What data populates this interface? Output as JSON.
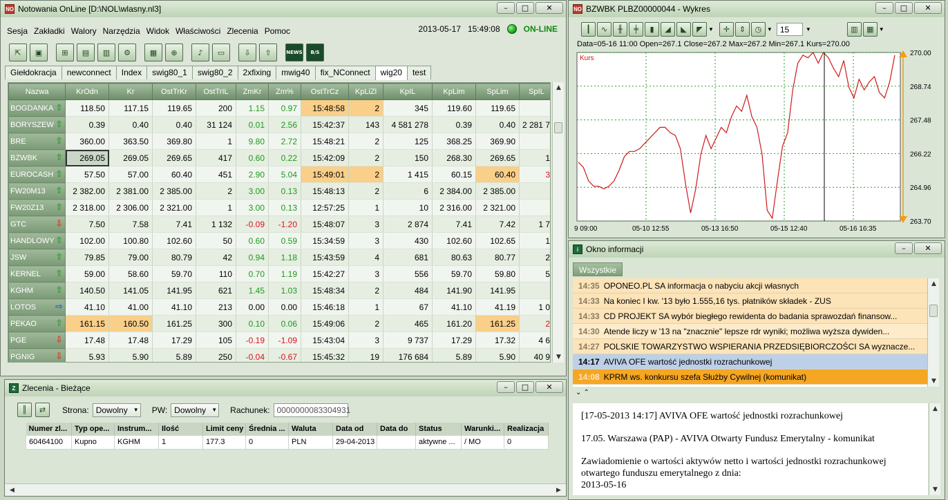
{
  "main_window": {
    "title": "Notowania OnLine [D:\\NOL\\wlasny.nl3]",
    "menu": [
      "Sesja",
      "Zakładki",
      "Walory",
      "Narzędzia",
      "Widok",
      "Właściwości",
      "Zlecenia",
      "Pomoc"
    ],
    "date": "2013-05-17",
    "time": "15:49:08",
    "status": "ON-LINE",
    "tabs": [
      "Giełdokracja",
      "newconnect",
      "Index",
      "swig80_1",
      "swig80_2",
      "2xfixing",
      "mwig40",
      "fix_NConnect",
      "wig20",
      "test"
    ],
    "active_tab": "wig20",
    "columns": [
      "Nazwa",
      "KrOdn",
      "Kr",
      "OstTrKr",
      "OstTrIL",
      "ZmKr",
      "Zm%",
      "OstTrCz",
      "KpLiZl",
      "KpIL",
      "KpLim",
      "SpLim",
      "SpIL"
    ],
    "rows": [
      {
        "n": "BOGDANKA",
        "a": "up",
        "v": [
          "118.50",
          "117.15",
          "119.65",
          "200",
          "1.15",
          "0.97",
          "15:48:58",
          "2",
          "345",
          "119.60",
          "119.65",
          ""
        ]
      },
      {
        "n": "BORYSZEW",
        "a": "up",
        "v": [
          "0.39",
          "0.40",
          "0.40",
          "31 124",
          "0.01",
          "2.56",
          "15:42:37",
          "143",
          "4 581 278",
          "0.39",
          "0.40",
          "2 281 7"
        ]
      },
      {
        "n": "BRE",
        "a": "up",
        "v": [
          "360.00",
          "363.50",
          "369.80",
          "1",
          "9.80",
          "2.72",
          "15:48:21",
          "2",
          "125",
          "368.25",
          "369.90",
          ""
        ]
      },
      {
        "n": "BZWBK",
        "a": "up",
        "v": [
          "269.05",
          "269.05",
          "269.65",
          "417",
          "0.60",
          "0.22",
          "15:42:09",
          "2",
          "150",
          "268.30",
          "269.65",
          "1"
        ]
      },
      {
        "n": "EUROCASH",
        "a": "up",
        "v": [
          "57.50",
          "57.00",
          "60.40",
          "451",
          "2.90",
          "5.04",
          "15:49:01",
          "2",
          "1 415",
          "60.15",
          "60.40",
          "3"
        ]
      },
      {
        "n": "FW20M13",
        "a": "up",
        "v": [
          "2 382.00",
          "2 381.00",
          "2 385.00",
          "2",
          "3.00",
          "0.13",
          "15:48:13",
          "2",
          "6",
          "2 384.00",
          "2 385.00",
          ""
        ]
      },
      {
        "n": "FW20Z13",
        "a": "up",
        "v": [
          "2 318.00",
          "2 306.00",
          "2 321.00",
          "1",
          "3.00",
          "0.13",
          "12:57:25",
          "1",
          "10",
          "2 316.00",
          "2 321.00",
          ""
        ]
      },
      {
        "n": "GTC",
        "a": "down",
        "v": [
          "7.50",
          "7.58",
          "7.41",
          "1 132",
          "-0.09",
          "-1.20",
          "15:48:07",
          "3",
          "2 874",
          "7.41",
          "7.42",
          "1 7"
        ]
      },
      {
        "n": "HANDLOWY",
        "a": "up",
        "v": [
          "102.00",
          "100.80",
          "102.60",
          "50",
          "0.60",
          "0.59",
          "15:34:59",
          "3",
          "430",
          "102.60",
          "102.65",
          "1"
        ]
      },
      {
        "n": "JSW",
        "a": "up",
        "v": [
          "79.85",
          "79.00",
          "80.79",
          "42",
          "0.94",
          "1.18",
          "15:43:59",
          "4",
          "681",
          "80.63",
          "80.77",
          "2"
        ]
      },
      {
        "n": "KERNEL",
        "a": "up",
        "v": [
          "59.00",
          "58.60",
          "59.70",
          "110",
          "0.70",
          "1.19",
          "15:42:27",
          "3",
          "556",
          "59.70",
          "59.80",
          "5"
        ]
      },
      {
        "n": "KGHM",
        "a": "up",
        "v": [
          "140.50",
          "141.05",
          "141.95",
          "621",
          "1.45",
          "1.03",
          "15:48:34",
          "2",
          "484",
          "141.90",
          "141.95",
          ""
        ]
      },
      {
        "n": "LOTOS",
        "a": "flat",
        "v": [
          "41.10",
          "41.00",
          "41.10",
          "213",
          "0.00",
          "0.00",
          "15:46:18",
          "1",
          "67",
          "41.10",
          "41.19",
          "1 0"
        ]
      },
      {
        "n": "PEKAO",
        "a": "up",
        "v": [
          "161.15",
          "160.50",
          "161.25",
          "300",
          "0.10",
          "0.06",
          "15:49:06",
          "2",
          "465",
          "161.20",
          "161.25",
          "2"
        ]
      },
      {
        "n": "PGE",
        "a": "down",
        "v": [
          "17.48",
          "17.48",
          "17.29",
          "105",
          "-0.19",
          "-1.09",
          "15:43:04",
          "3",
          "9 737",
          "17.29",
          "17.32",
          "4 6"
        ]
      },
      {
        "n": "PGNIG",
        "a": "down",
        "v": [
          "5.93",
          "5.90",
          "5.89",
          "250",
          "-0.04",
          "-0.67",
          "15:45:32",
          "19",
          "176 684",
          "5.89",
          "5.90",
          "40 9"
        ]
      }
    ]
  },
  "chart_window": {
    "title": "BZWBK PLBZ00000044 - Wykres",
    "period": "15",
    "info": "Data=05-16 11:00 Open=267.1 Close=267.2 Max=267.2 Min=267.1 Kurs=270.00",
    "legend": "Kurs"
  },
  "chart_data": {
    "type": "line",
    "series": [
      {
        "name": "Kurs",
        "values": [
          265.9,
          265.7,
          265.2,
          265.0,
          265.0,
          264.9,
          265.0,
          265.2,
          265.6,
          266.1,
          266.3,
          266.3,
          266.4,
          266.6,
          266.8,
          267.0,
          267.2,
          267.2,
          267.0,
          266.9,
          266.4,
          265.1,
          264.0,
          264.9,
          266.2,
          266.9,
          266.4,
          266.8,
          267.2,
          267.0,
          267.6,
          268.0,
          267.8,
          268.4,
          267.6,
          267.2,
          266.2,
          264.1,
          263.8,
          265.2,
          266.5,
          267.0,
          268.6,
          269.6,
          269.9,
          269.8,
          270.0,
          269.6,
          270.0,
          269.8,
          269.4,
          269.1,
          269.7,
          268.7,
          268.3,
          269.0,
          268.6,
          268.9,
          269.1,
          268.5,
          268.3,
          268.9,
          269.9
        ]
      }
    ],
    "x_ticks": [
      "9 09:00",
      "05-10 12:55",
      "05-13 16:50",
      "05-15 12:40",
      "05-16 16:35"
    ],
    "y_ticks": [
      "270.00",
      "268.74",
      "267.48",
      "266.22",
      "264.96",
      "263.70"
    ],
    "ylim": [
      263.7,
      270.0
    ],
    "grid": true,
    "color": "#cc1a1a"
  },
  "info_window": {
    "title": "Okno informacji",
    "tab": "Wszystkie",
    "news": [
      {
        "time": "14:35",
        "text": "OPONEO.PL SA informacja o nabyciu akcji własnych"
      },
      {
        "time": "14:33",
        "text": "Na koniec I kw. '13 było 1.555,16 tys. płatników składek - ZUS"
      },
      {
        "time": "14:33",
        "text": "CD PROJEKT SA wybór biegłego rewidenta do badania sprawozdań finansow..."
      },
      {
        "time": "14:30",
        "text": "Atende liczy w '13 na \"znacznie\" lepsze rdr wyniki; możliwa wyższa dywiden..."
      },
      {
        "time": "14:27",
        "text": "POLSKIE TOWARZYSTWO WSPIERANIA PRZEDSIĘBIORCZOŚCI SA wyznacze..."
      },
      {
        "time": "14:17",
        "text": "AVIVA OFE wartość jednostki rozrachunkowej"
      },
      {
        "time": "14:08",
        "text": "KPRM ws. konkursu szefa Służby Cywilnej (komunikat)"
      }
    ],
    "body": [
      "[17-05-2013 14:17] AVIVA OFE wartość jednostki rozrachunkowej",
      "17.05. Warszawa (PAP) - AVIVA Otwarty Fundusz Emerytalny - komunikat",
      "Zawiadomienie o wartości aktywów netto i wartości jednostki rozrachunkowej otwartego funduszu emerytalnego z dnia:",
      "2013-05-16"
    ]
  },
  "orders_window": {
    "title": "Zlecenia - Bieżące",
    "strona_label": "Strona:",
    "strona_value": "Dowolny",
    "pw_label": "PW:",
    "pw_value": "Dowolny",
    "rachunek_label": "Rachunek:",
    "rachunek_value": "0000000083304931",
    "columns": [
      "Numer zl...",
      "Typ ope...",
      "Instrum...",
      "Ilość",
      "Limit ceny",
      "Średnia ...",
      "Waluta",
      "Data od",
      "Data do",
      "Status",
      "Warunki...",
      "Realizacja"
    ],
    "row": [
      "60464100",
      "Kupno",
      "KGHM",
      "1",
      "177.3",
      "0",
      "PLN",
      "29-04-2013",
      "",
      "aktywne ...",
      "/ MO",
      "0"
    ]
  }
}
